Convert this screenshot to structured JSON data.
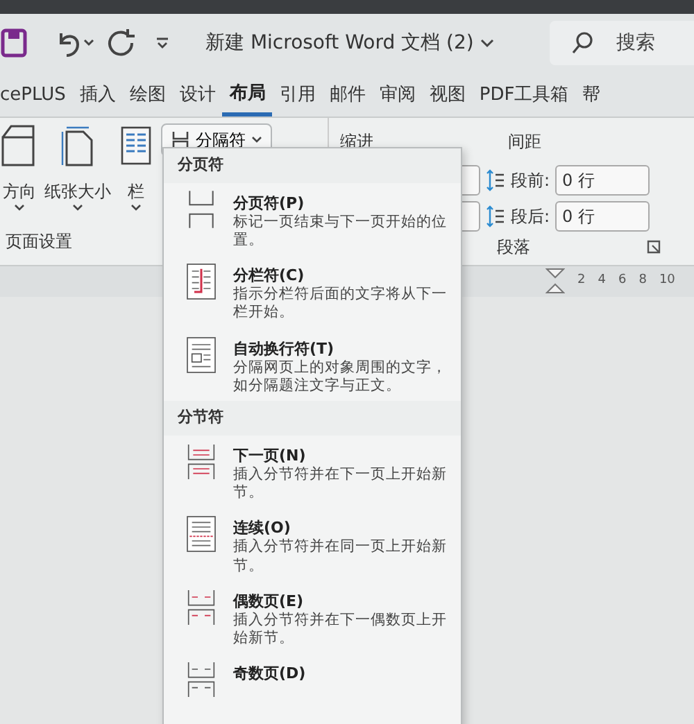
{
  "title_bar": {
    "title": "新建 Microsoft Word 文档 (2)",
    "search_placeholder": "搜索"
  },
  "tabs": [
    {
      "label": "cePLUS",
      "selected": false
    },
    {
      "label": "插入",
      "selected": false
    },
    {
      "label": "绘图",
      "selected": false
    },
    {
      "label": "设计",
      "selected": false
    },
    {
      "label": "布局",
      "selected": true
    },
    {
      "label": "引用",
      "selected": false
    },
    {
      "label": "邮件",
      "selected": false
    },
    {
      "label": "审阅",
      "selected": false
    },
    {
      "label": "视图",
      "selected": false
    },
    {
      "label": "PDF工具箱",
      "selected": false
    },
    {
      "label": "帮",
      "selected": false
    }
  ],
  "ribbon": {
    "page_setup": {
      "buttons": [
        {
          "kind": "orientation",
          "label": "方向"
        },
        {
          "kind": "size",
          "label": "纸张大小"
        },
        {
          "kind": "columns",
          "label": "栏"
        }
      ],
      "group_label": "页面设置"
    },
    "breaks_button": "分隔符",
    "indent_label": "缩进",
    "spacing": {
      "label": "间距",
      "before_label": "段前:",
      "before_value": "0 行",
      "after_label": "段后:",
      "after_value": "0 行"
    },
    "paragraph_group_label": "段落"
  },
  "ruler": [
    "2",
    "4",
    "6",
    "8",
    "10"
  ],
  "breaks_menu": {
    "sections": [
      {
        "heading": "分页符",
        "items": [
          {
            "kind": "page",
            "title": "分页符(P)",
            "description": "标记一页结束与下一页开始的位置。"
          },
          {
            "kind": "column",
            "title": "分栏符(C)",
            "description": "指示分栏符后面的文字将从下一栏开始。"
          },
          {
            "kind": "wrap",
            "title": "自动换行符(T)",
            "description": "分隔网页上的对象周围的文字，如分隔题注文字与正文。"
          }
        ]
      },
      {
        "heading": "分节符",
        "items": [
          {
            "kind": "next",
            "title": "下一页(N)",
            "description": "插入分节符并在下一页上开始新节。"
          },
          {
            "kind": "continuous",
            "title": "连续(O)",
            "description": "插入分节符并在同一页上开始新节。"
          },
          {
            "kind": "even",
            "title": "偶数页(E)",
            "description": "插入分节符并在下一偶数页上开始新节。"
          },
          {
            "kind": "odd",
            "title": "奇数页(D)"
          }
        ]
      }
    ]
  }
}
